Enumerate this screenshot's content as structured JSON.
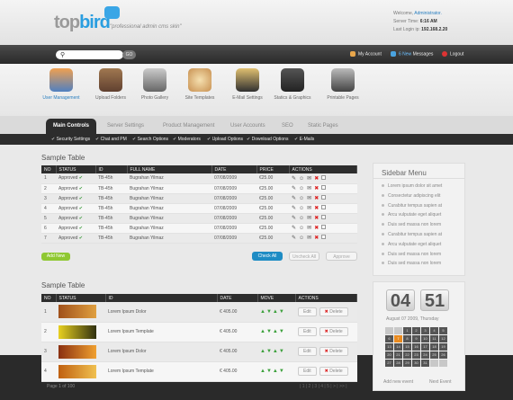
{
  "logo": {
    "word_a": "top",
    "word_b": "bird",
    "tagline": "\"professional admin cms skin\""
  },
  "session": {
    "welcome_label": "Welcome,",
    "user": "Administrator.",
    "server_time_label": "Server Time:",
    "server_time": "6:16 AM",
    "last_login_label": "Last Login ip:",
    "last_login_ip": "192.168.2.20"
  },
  "search": {
    "button": "GO"
  },
  "account": {
    "my_account": "My Account",
    "messages_count": "6 New",
    "messages_label": "Messages",
    "logout": "Logout"
  },
  "modules": [
    "User Management",
    "Upload Folders",
    "Photo Gallery",
    "Site Templates",
    "E-Mail Settings",
    "Statics & Graphics",
    "Printable Pages"
  ],
  "tabs": [
    "Main Controls",
    "Server Settings",
    "Product Management",
    "User Accounts",
    "SEO",
    "Static Pages"
  ],
  "subnav": [
    "Security Settings",
    "Chat and PM",
    "Search Options",
    "Moderators",
    "Upload Options",
    "Download Options",
    "E-Mails"
  ],
  "table1": {
    "title": "Sample Table",
    "headers": [
      "NO",
      "STATUS",
      "ID",
      "FULL NAME",
      "DATE",
      "PRICE",
      "ACTIONS"
    ],
    "rows": [
      {
        "no": "1",
        "status": "Approved",
        "id": "TB-45h",
        "name": "Bugrahan Yilmaz",
        "date": "07/08/2009",
        "price": "€25.00"
      },
      {
        "no": "2",
        "status": "Approved",
        "id": "TB-45h",
        "name": "Bugrahan Yilmaz",
        "date": "07/08/2009",
        "price": "€25.00"
      },
      {
        "no": "3",
        "status": "Approved",
        "id": "TB-45h",
        "name": "Bugrahan Yilmaz",
        "date": "07/08/2009",
        "price": "€25.00"
      },
      {
        "no": "4",
        "status": "Approved",
        "id": "TB-45h",
        "name": "Bugrahan Yilmaz",
        "date": "07/08/2009",
        "price": "€25.00"
      },
      {
        "no": "5",
        "status": "Approved",
        "id": "TB-45h",
        "name": "Bugrahan Yilmaz",
        "date": "07/08/2009",
        "price": "€25.00"
      },
      {
        "no": "6",
        "status": "Approved",
        "id": "TB-45h",
        "name": "Bugrahan Yilmaz",
        "date": "07/08/2009",
        "price": "€25.00"
      },
      {
        "no": "7",
        "status": "Approved",
        "id": "TB-45h",
        "name": "Bugrahan Yilmaz",
        "date": "07/08/2009",
        "price": "€25.00"
      }
    ],
    "add_new": "Add New",
    "check_all": "Check All",
    "uncheck_all": "Uncheck All",
    "approve": "Approve"
  },
  "table2": {
    "title": "Sample Table",
    "headers": [
      "NO",
      "STATUS",
      "ID",
      "DATE",
      "MOVE",
      "ACTIONS"
    ],
    "rows": [
      {
        "no": "1",
        "id": "Lorem Ipsum Dolor",
        "date": "€ 405.00"
      },
      {
        "no": "2",
        "id": "Lorem Ipsum Template",
        "date": "€ 405.00"
      },
      {
        "no": "3",
        "id": "Lorem Ipsum Dolor",
        "date": "€ 405.00"
      },
      {
        "no": "4",
        "id": "Lorem Ipsum Template",
        "date": "€ 405.00"
      }
    ],
    "edit": "Edit",
    "delete": "Delete",
    "page_info": "Page 1 of 100",
    "pages": "| 1 | 2 | 3 | 4 | 5 | > | >> |"
  },
  "sidebar": {
    "title": "Sidebar Menu",
    "items": [
      "Lorem ipsum dolor sit amet",
      "Consectetur adipiscing elit",
      "Curabitur tempus sapien at",
      "Arcu vulputate eget aliquet",
      "Duis sed massa non lorem",
      "Curabitur tempus sapien at",
      "Arcu vulputate eget aliquet",
      "Duis sed massa non lorem",
      "Duis sed massa non lorem"
    ]
  },
  "clock": {
    "hours": "04",
    "minutes": "51",
    "date": "August 07 2009, Thursday",
    "add_event": "Add new event",
    "next_event": "Next Event"
  },
  "calendar": {
    "days": [
      "",
      "",
      "1",
      "2",
      "3",
      "4",
      "5",
      "6",
      "7",
      "8",
      "9",
      "10",
      "11",
      "12",
      "13",
      "14",
      "15",
      "16",
      "17",
      "18",
      "19",
      "20",
      "21",
      "22",
      "23",
      "24",
      "25",
      "26",
      "27",
      "28",
      "29",
      "30",
      "31",
      "",
      ""
    ],
    "today": "7"
  },
  "colors": {
    "accent": "#2a9ee0",
    "dark_bar": "#2d2d2d",
    "add_button": "#8fc832",
    "check_button": "#1e8cc4",
    "calendar_today": "#e98a1f"
  }
}
